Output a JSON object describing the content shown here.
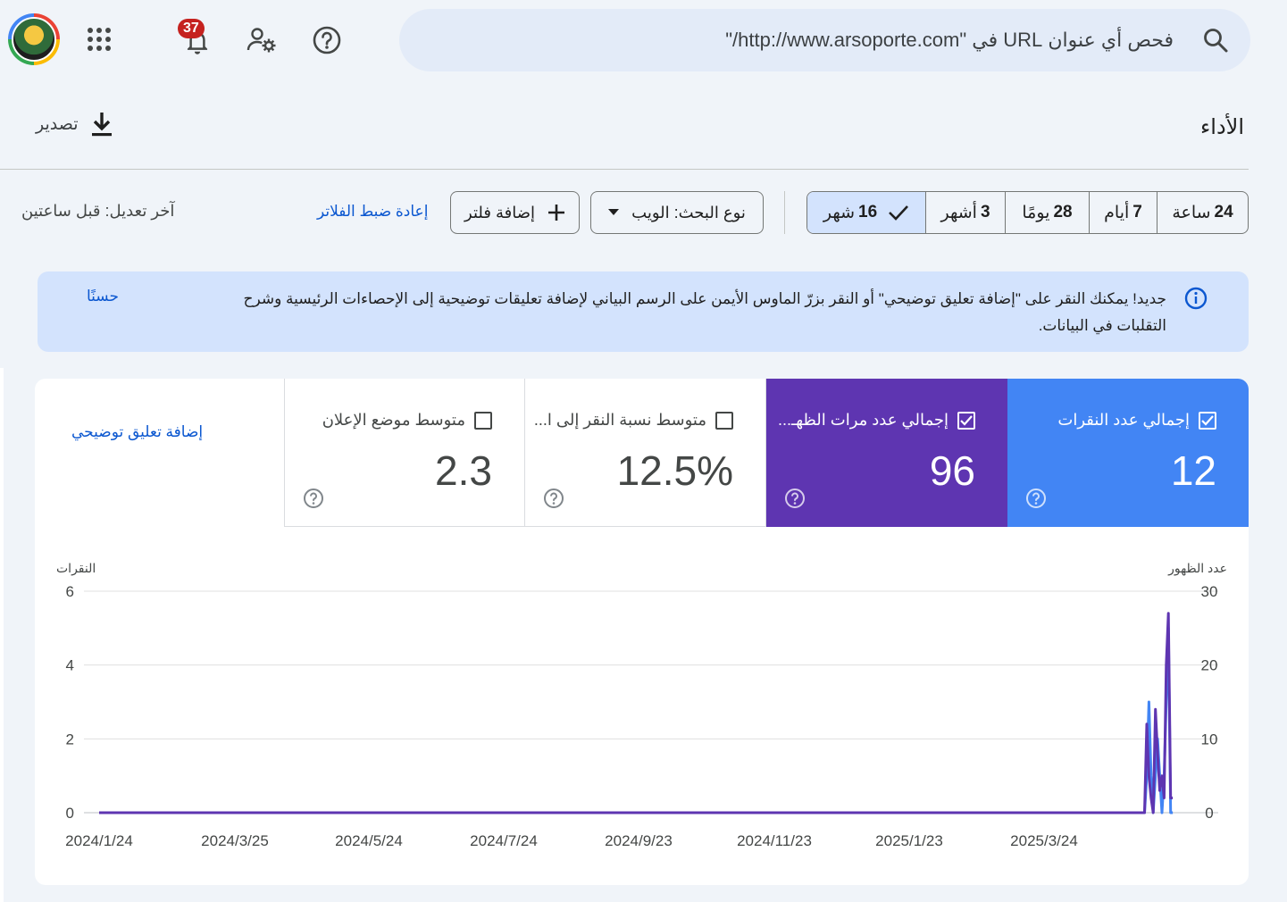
{
  "topbar": {
    "search_text": "فحص أي عنوان URL في \"http://www.arsoporte.com/\"",
    "notifications_count": "37"
  },
  "header": {
    "title": "الأداء",
    "export_label": "تصدير"
  },
  "filters": {
    "ranges": [
      {
        "num": "24",
        "unit": "ساعة",
        "active": false
      },
      {
        "num": "7",
        "unit": "أيام",
        "active": false
      },
      {
        "num": "28",
        "unit": "يومًا",
        "active": false
      },
      {
        "num": "3",
        "unit": "أشهر",
        "active": false
      },
      {
        "num": "16",
        "unit": "شهر",
        "active": true
      }
    ],
    "search_type": "نوع البحث: الويب",
    "add_filter": "إضافة فلتر",
    "reset_filters": "إعادة ضبط الفلاتر",
    "last_modified": "آخر تعديل: قبل ساعتين"
  },
  "banner": {
    "text": "جديد! يمكنك النقر على \"إضافة تعليق توضيحي\" أو النقر بزرّ الماوس الأيمن على الرسم البياني لإضافة تعليقات توضيحية إلى الإحصاءات الرئيسية وشرح التقلبات في البيانات.",
    "dismiss": "حسنًا"
  },
  "metrics": [
    {
      "label": "إجمالي عدد النقرات",
      "value": "12",
      "checked": true,
      "color": "#4285f4"
    },
    {
      "label": "إجمالي عدد مرات الظهـ...",
      "value": "96",
      "checked": true,
      "color": "#5e35b1"
    },
    {
      "label": "متوسط نسبة النقر إلى ا...",
      "value": "12.5%",
      "checked": false,
      "color": "#ffffff"
    },
    {
      "label": "متوسط موضع الإعلان",
      "value": "2.3",
      "checked": false,
      "color": "#ffffff"
    }
  ],
  "add_annotation": "إضافة تعليق توضيحي",
  "chart_data": {
    "type": "line",
    "left_axis_label": "النقرات",
    "right_axis_label": "عدد الظهور",
    "left_ticks": [
      "6",
      "4",
      "2",
      "0"
    ],
    "right_ticks": [
      "30",
      "20",
      "10",
      "0"
    ],
    "x_ticks": [
      "2024/1/24",
      "2024/3/25",
      "2024/5/24",
      "2024/7/24",
      "2024/9/23",
      "2024/11/23",
      "2025/1/23",
      "2025/3/24"
    ],
    "left_ylim": [
      0,
      6
    ],
    "right_ylim": [
      0,
      30
    ],
    "series": [
      {
        "name": "إجمالي عدد النقرات",
        "axis": "left",
        "color": "#4285f4",
        "points": [
          [
            0,
            0
          ],
          [
            0.965,
            0
          ],
          [
            0.967,
            1
          ],
          [
            0.969,
            3
          ],
          [
            0.971,
            1
          ],
          [
            0.973,
            0
          ],
          [
            0.975,
            1
          ],
          [
            0.977,
            2
          ],
          [
            0.979,
            1
          ],
          [
            0.981,
            0
          ],
          [
            0.983,
            1
          ],
          [
            0.985,
            3
          ],
          [
            0.987,
            5
          ],
          [
            0.989,
            0
          ],
          [
            0.991,
            0
          ]
        ]
      },
      {
        "name": "إجمالي عدد مرات الظهـ...",
        "axis": "right",
        "color": "#5e35b1",
        "points": [
          [
            0,
            0
          ],
          [
            0.965,
            0
          ],
          [
            0.967,
            12
          ],
          [
            0.969,
            5
          ],
          [
            0.971,
            2
          ],
          [
            0.973,
            0
          ],
          [
            0.975,
            14
          ],
          [
            0.977,
            8
          ],
          [
            0.979,
            3
          ],
          [
            0.981,
            5
          ],
          [
            0.983,
            2
          ],
          [
            0.985,
            20
          ],
          [
            0.987,
            27
          ],
          [
            0.989,
            2
          ],
          [
            0.991,
            2
          ]
        ]
      }
    ]
  }
}
